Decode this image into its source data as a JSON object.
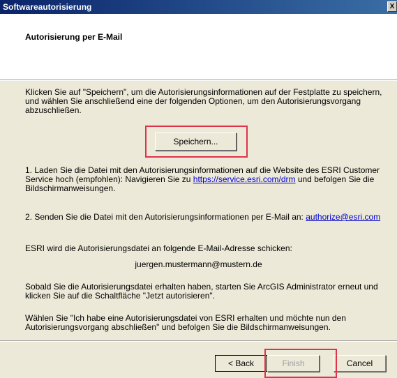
{
  "window": {
    "title": "Softwareautorisierung",
    "close_glyph": "X"
  },
  "header": {
    "title": "Autorisierung per E-Mail"
  },
  "intro": "Klicken Sie auf \"Speichern\", um die Autorisierungsinformationen auf der Festplatte zu speichern, und wählen Sie anschließend eine der folgenden Optionen, um den Autorisierungsvorgang abzuschließen.",
  "save_button": "Speichern...",
  "option1": {
    "before": "1.  Laden Sie die Datei mit den Autorisierungsinformationen auf die Website des ESRI Customer Service hoch (empfohlen): Navigieren Sie zu ",
    "link": "https://service.esri.com/drm",
    "after": " und befolgen Sie die Bildschirmanweisungen."
  },
  "option2": {
    "before": "2.  Senden Sie die Datei mit den Autorisierungsinformationen per E-Mail an: ",
    "link": "authorize@esri.com"
  },
  "esri_send_text": "ESRI wird die Autorisierungsdatei an folgende E-Mail-Adresse schicken:",
  "email_address": "juergen.mustermann@mustern.de",
  "restart_text": "Sobald Sie die Autorisierungsdatei erhalten haben, starten Sie ArcGIS Administrator erneut und klicken Sie auf die Schaltfläche \"Jetzt autorisieren\".",
  "choose_text": "Wählen Sie \"Ich habe eine Autorisierungsdatei von ESRI erhalten und möchte nun den Autorisierungsvorgang abschließen\" und befolgen Sie die Bildschirmanweisungen.",
  "buttons": {
    "back": "< Back",
    "finish": "Finish",
    "cancel": "Cancel"
  },
  "colors": {
    "highlight": "#e0324a",
    "titlebar": "#0a246a",
    "dialog_bg": "#ece9d8",
    "link": "#0000cc"
  }
}
